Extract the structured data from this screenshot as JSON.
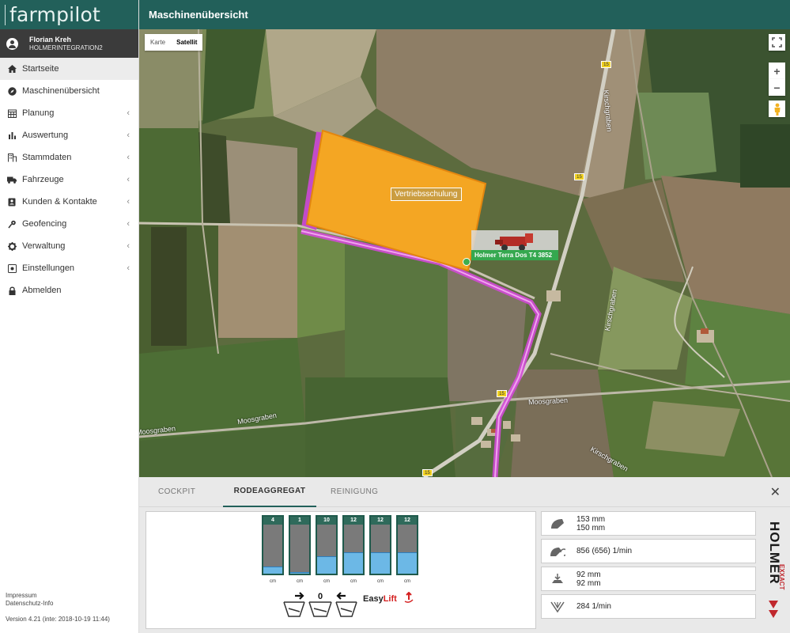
{
  "app": {
    "brand": "farmpilot",
    "page_title": "Maschinenübersicht"
  },
  "user": {
    "name": "Florian Kreh",
    "org": "HOLMERINTEGRATION2"
  },
  "nav": {
    "items": [
      {
        "label": "Startseite",
        "icon": "home-icon",
        "active": true,
        "sub": false
      },
      {
        "label": "Maschinenübersicht",
        "icon": "compass-icon",
        "active": false,
        "sub": false
      },
      {
        "label": "Planung",
        "icon": "calendar-icon",
        "active": false,
        "sub": true
      },
      {
        "label": "Auswertung",
        "icon": "bar-chart-icon",
        "active": false,
        "sub": true
      },
      {
        "label": "Stammdaten",
        "icon": "building-icon",
        "active": false,
        "sub": true
      },
      {
        "label": "Fahrzeuge",
        "icon": "truck-icon",
        "active": false,
        "sub": true
      },
      {
        "label": "Kunden & Kontakte",
        "icon": "address-book-icon",
        "active": false,
        "sub": true
      },
      {
        "label": "Geofencing",
        "icon": "map-pin-icon",
        "active": false,
        "sub": true
      },
      {
        "label": "Verwaltung",
        "icon": "gear-icon",
        "active": false,
        "sub": true
      },
      {
        "label": "Einstellungen",
        "icon": "settings-box-icon",
        "active": false,
        "sub": true
      },
      {
        "label": "Abmelden",
        "icon": "lock-icon",
        "active": false,
        "sub": false
      }
    ]
  },
  "footer": {
    "impressum": "Impressum",
    "datenschutz": "Datenschutz-Info",
    "version": "Version 4.21 (inte: 2018-10-19 11:44)"
  },
  "map": {
    "type_karte": "Karte",
    "type_satellit": "Satellit",
    "zoom_in": "+",
    "zoom_out": "−",
    "field_label": "Vertriebsschulung",
    "machine_label": "Holmer Terra Dos T4 3852",
    "road_labels": [
      "Moosgraben",
      "Moosgraben",
      "Moosgraben",
      "Kirschgraben",
      "Kirschgraben",
      "Kirschgraben"
    ],
    "road_signs": [
      "15",
      "15",
      "15",
      "15"
    ]
  },
  "panel": {
    "tabs": [
      "COCKPIT",
      "RODEAGGREGAT",
      "REINIGUNG"
    ],
    "active_tab": "RODEAGGREGAT",
    "close": "✕",
    "gauges": [
      {
        "value": "4",
        "unit": "cm",
        "fill": 0.14
      },
      {
        "value": "1",
        "unit": "cm",
        "fill": 0.04
      },
      {
        "value": "10",
        "unit": "cm",
        "fill": 0.36
      },
      {
        "value": "12",
        "unit": "cm",
        "fill": 0.44
      },
      {
        "value": "12",
        "unit": "cm",
        "fill": 0.44
      },
      {
        "value": "12",
        "unit": "cm",
        "fill": 0.44
      }
    ],
    "center_value": "0",
    "easylift": {
      "easy": "Easy",
      "lift": "Lift"
    },
    "readings": [
      {
        "icon": "depth-icon",
        "lines": [
          "153 mm",
          "150 mm"
        ]
      },
      {
        "icon": "rotation-icon",
        "lines": [
          "856 (656) 1/min"
        ]
      },
      {
        "icon": "share-depth-icon",
        "lines": [
          "92 mm",
          "92 mm"
        ]
      },
      {
        "icon": "sieve-speed-icon",
        "lines": [
          "284 1/min"
        ]
      }
    ],
    "logo": {
      "main": "HOLMER",
      "sub": "EXXACT"
    }
  }
}
